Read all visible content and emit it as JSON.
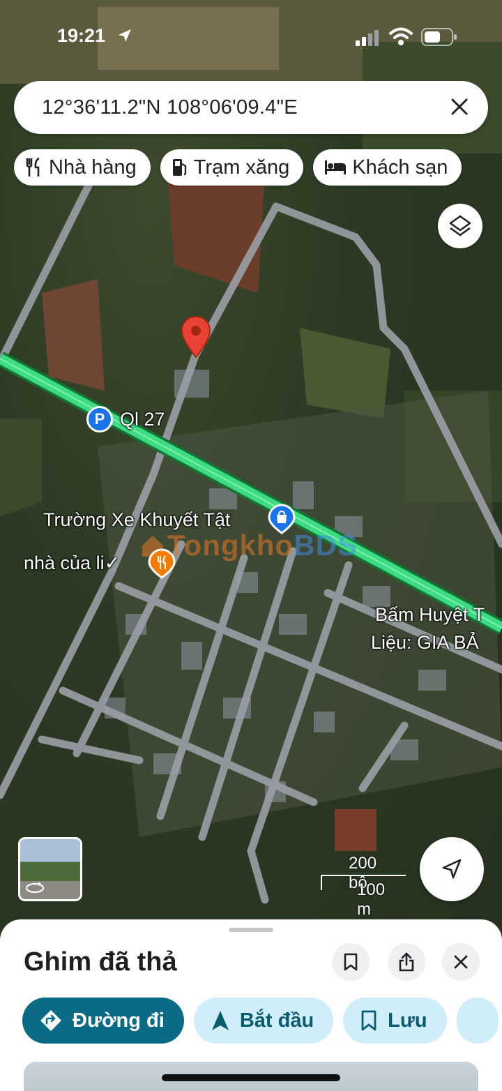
{
  "status_bar": {
    "time": "19:21"
  },
  "search": {
    "query": "12°36'11.2\"N 108°06'09.4\"E"
  },
  "chips": [
    {
      "label": "Nhà hàng",
      "icon": "restaurant-icon"
    },
    {
      "label": "Trạm xăng",
      "icon": "gas-station-icon"
    },
    {
      "label": "Khách sạn",
      "icon": "hotel-icon"
    }
  ],
  "map": {
    "labels": {
      "road": "Ql 27",
      "school": "Trường Xe Khuyết Tật",
      "house": "nhà của li✓",
      "place_line1": "Bấm Huyệt T",
      "place_line2": "Liệu: GIA BẢ"
    },
    "watermark": {
      "part1": "Tongkho",
      "part2": "BDS"
    },
    "scale": {
      "imperial": "200 bộ",
      "metric": "100 m"
    },
    "highlight_color": "#3ddc84"
  },
  "sheet": {
    "title": "Ghim đã thả",
    "actions": [
      {
        "label": "Đường đi"
      },
      {
        "label": "Bắt đầu"
      },
      {
        "label": "Lưu"
      }
    ]
  }
}
